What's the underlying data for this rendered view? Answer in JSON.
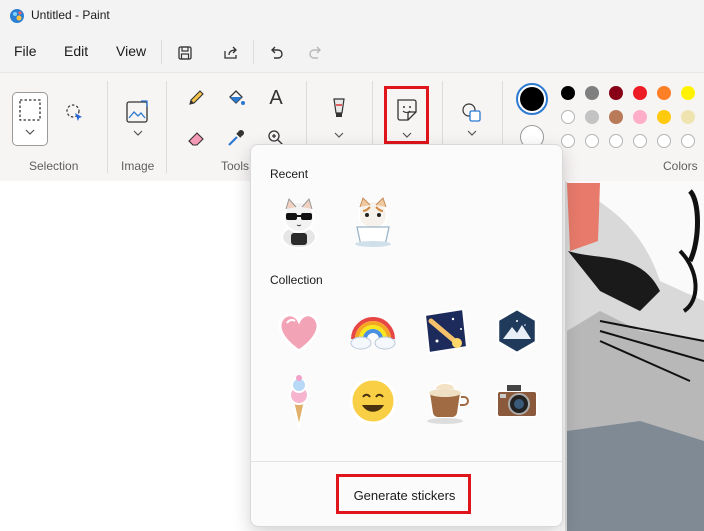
{
  "titlebar": {
    "title": "Untitled - Paint"
  },
  "menu": {
    "file": "File",
    "edit": "Edit",
    "view": "View"
  },
  "ribbon": {
    "groups": {
      "selection": "Selection",
      "image": "Image",
      "tools": "Tools",
      "colors": "Colors"
    },
    "primary_color": "#000000",
    "secondary_color": "#ffffff",
    "palette_row1": [
      "#000000",
      "#7f7f7f",
      "#880015",
      "#ed1c24",
      "#ff7f27",
      "#fff200"
    ],
    "palette_row2": [
      "#ffffff",
      "#c3c3c3",
      "#b97a57",
      "#ffaec9",
      "#ffc90e",
      "#efe4b0"
    ]
  },
  "stickers_panel": {
    "recent_label": "Recent",
    "collection_label": "Collection",
    "recent": [
      "cat-sunglasses-sticker",
      "cat-coffee-cup-sticker"
    ],
    "collection": [
      "heart-sticker",
      "rainbow-sticker",
      "shooting-star-sticker",
      "mountain-badge-sticker",
      "ice-cream-sticker",
      "smiley-sticker",
      "coffee-cup-sticker",
      "camera-sticker"
    ],
    "generate_label": "Generate stickers"
  }
}
